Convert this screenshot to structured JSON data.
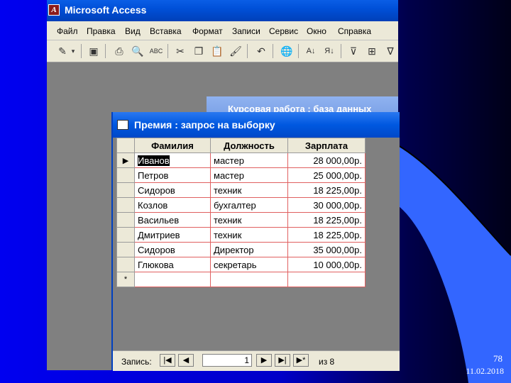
{
  "app": {
    "title": "Microsoft Access"
  },
  "menu": [
    "Файл",
    "Правка",
    "Вид",
    "Вставка",
    "Формат",
    "Записи",
    "Сервис",
    "Окно",
    "Справка"
  ],
  "toolbar_icons": [
    "design-view-icon",
    "save-icon",
    "print-icon",
    "print-preview-icon",
    "spelling-icon",
    "cut-icon",
    "copy-icon",
    "paste-icon",
    "format-painter-icon",
    "undo-icon",
    "hyperlink-icon",
    "sort-ascending-icon",
    "sort-descending-icon",
    "filter-by-selection-icon",
    "filter-by-form-icon",
    "apply-filter-icon"
  ],
  "background_window": {
    "title": "Курсовая работа : база данных"
  },
  "query_window": {
    "title": "Премия : запрос на выборку",
    "columns": [
      "Фамилия",
      "Должность",
      "Зарплата"
    ],
    "rows": [
      [
        "Иванов",
        "мастер",
        "28 000,00р."
      ],
      [
        "Петров",
        "мастер",
        "25 000,00р."
      ],
      [
        "Сидоров",
        "техник",
        "18 225,00р."
      ],
      [
        "Козлов",
        "бухгалтер",
        "30 000,00р."
      ],
      [
        "Васильев",
        "техник",
        "18 225,00р."
      ],
      [
        "Дмитриев",
        "техник",
        "18 225,00р."
      ],
      [
        "Сидоров",
        "Директор",
        "35 000,00р."
      ],
      [
        "Глюкова",
        "секретарь",
        "10 000,00р."
      ]
    ],
    "new_row_marker": "*",
    "current_marker": "▶"
  },
  "navigation": {
    "label": "Запись:",
    "current": "1",
    "of_label": "из 8"
  },
  "slide": {
    "number": "78",
    "date": "11.02.2018"
  }
}
